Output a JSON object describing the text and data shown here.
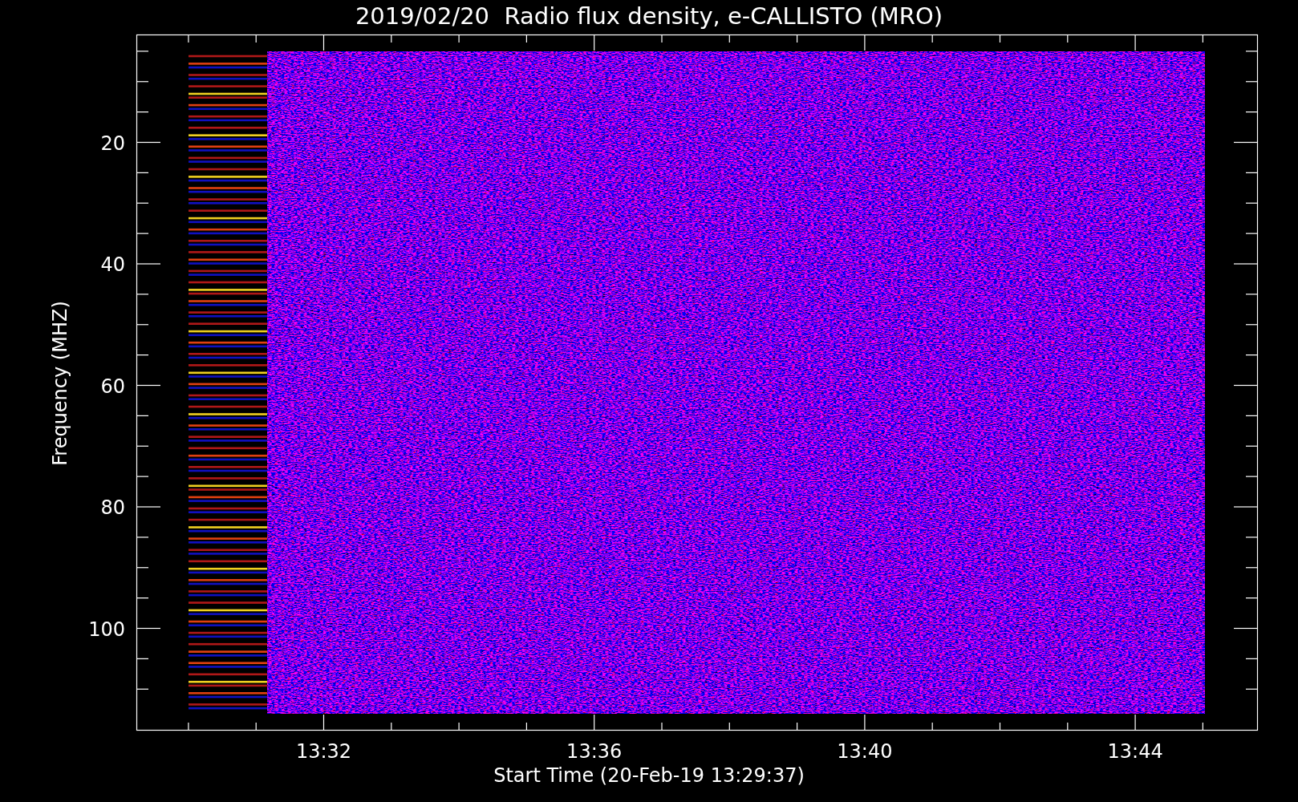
{
  "title": "2019/02/20  Radio flux density, e-CALLISTO (MRO)",
  "y_axis": {
    "label": "Frequency (MHZ)",
    "ticks": [
      "20",
      "40",
      "60",
      "80",
      "100"
    ]
  },
  "x_axis": {
    "label": "Start Time (20-Feb-19 13:29:37)",
    "ticks": [
      "13:32",
      "13:36",
      "13:40",
      "13:44"
    ]
  }
}
